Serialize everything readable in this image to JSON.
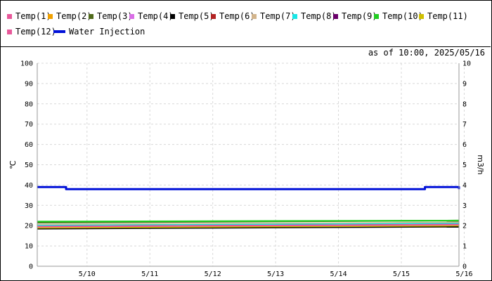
{
  "stamp": "as of 10:00, 2025/05/16",
  "legend": [
    {
      "name": "Temp(1)",
      "color": "#e8589a",
      "kind": "square"
    },
    {
      "name": "Temp(2)",
      "color": "#f0a000",
      "kind": "square"
    },
    {
      "name": "Temp(3)",
      "color": "#4f6a1a",
      "kind": "square"
    },
    {
      "name": "Temp(4)",
      "color": "#d96ee6",
      "kind": "square"
    },
    {
      "name": "Temp(5)",
      "color": "#000000",
      "kind": "square"
    },
    {
      "name": "Temp(6)",
      "color": "#b22222",
      "kind": "square"
    },
    {
      "name": "Temp(7)",
      "color": "#d2b48c",
      "kind": "square"
    },
    {
      "name": "Temp(8)",
      "color": "#19e6e6",
      "kind": "square"
    },
    {
      "name": "Temp(9)",
      "color": "#6a006a",
      "kind": "square"
    },
    {
      "name": "Temp(10)",
      "color": "#22cc22",
      "kind": "square"
    },
    {
      "name": "Temp(11)",
      "color": "#cfc000",
      "kind": "square"
    },
    {
      "name": "Temp(12)",
      "color": "#e8589a",
      "kind": "square"
    },
    {
      "name": "Water Injection",
      "color": "#0010d8",
      "kind": "line"
    }
  ],
  "chart_data": {
    "type": "line",
    "xlabel": "",
    "ylabel": "℃",
    "y2label": "m3/h",
    "x_tick_labels": [
      "5/10",
      "5/11",
      "5/12",
      "5/13",
      "5/14",
      "5/15",
      "5/16"
    ],
    "x_start": "2025/05/09 17:00",
    "x_end": "2025/05/16 10:00",
    "ylim": [
      0,
      100
    ],
    "y2lim": [
      0,
      10
    ],
    "y_ticks": [
      0,
      10,
      20,
      30,
      40,
      50,
      60,
      70,
      80,
      90,
      100
    ],
    "y2_ticks": [
      0,
      1,
      2,
      3,
      4,
      5,
      6,
      7,
      8,
      9,
      10
    ],
    "grid": true,
    "legend_position": "top",
    "series": [
      {
        "name": "Temp(1)",
        "axis": "left",
        "color": "#e8589a",
        "x": [
          "2025/05/09 17:00",
          "2025/05/16 10:00"
        ],
        "values": [
          19.5,
          20.5
        ]
      },
      {
        "name": "Temp(2)",
        "axis": "left",
        "color": "#f0a000",
        "x": [
          "2025/05/09 17:00",
          "2025/05/16 10:00"
        ],
        "values": [
          19.0,
          19.5
        ]
      },
      {
        "name": "Temp(3)",
        "axis": "left",
        "color": "#4f6a1a",
        "x": [
          "2025/05/09 17:00",
          "2025/05/16 10:00"
        ],
        "values": [
          21.5,
          22.5
        ]
      },
      {
        "name": "Temp(4)",
        "axis": "left",
        "color": "#d96ee6",
        "x": [
          "2025/05/09 17:00",
          "2025/05/16 10:00"
        ],
        "values": [
          20.0,
          21.0
        ]
      },
      {
        "name": "Temp(5)",
        "axis": "left",
        "color": "#000000",
        "x": [
          "2025/05/09 17:00",
          "2025/05/16 10:00"
        ],
        "values": [
          18.5,
          19.5
        ]
      },
      {
        "name": "Temp(6)",
        "axis": "left",
        "color": "#b22222",
        "x": [
          "2025/05/09 17:00",
          "2025/05/16 10:00"
        ],
        "values": [
          20.0,
          21.5
        ]
      },
      {
        "name": "Temp(7)",
        "axis": "left",
        "color": "#d2b48c",
        "x": [
          "2025/05/09 17:00",
          "2025/05/16 10:00"
        ],
        "values": [
          20.5,
          21.5
        ]
      },
      {
        "name": "Temp(8)",
        "axis": "left",
        "color": "#19e6e6",
        "x": [
          "2025/05/09 17:00",
          "2025/05/16 10:00"
        ],
        "values": [
          20.0,
          21.0
        ]
      },
      {
        "name": "Temp(9)",
        "axis": "left",
        "color": "#6a006a",
        "x": [
          "2025/05/09 17:00",
          "2025/05/16 10:00"
        ],
        "values": [
          19.5,
          20.5
        ]
      },
      {
        "name": "Temp(10)",
        "axis": "left",
        "color": "#22cc22",
        "x": [
          "2025/05/09 17:00",
          "2025/05/16 10:00"
        ],
        "values": [
          22.0,
          22.5
        ]
      },
      {
        "name": "Temp(11)",
        "axis": "left",
        "color": "#cfc000",
        "x": [
          "2025/05/09 17:00",
          "2025/05/16 10:00"
        ],
        "values": [
          19.0,
          20.0
        ]
      },
      {
        "name": "Temp(12)",
        "axis": "left",
        "color": "#e8589a",
        "x": [
          "2025/05/09 17:00",
          "2025/05/16 10:00"
        ],
        "values": [
          19.5,
          20.5
        ]
      },
      {
        "name": "Water Injection",
        "axis": "right",
        "color": "#0010d8",
        "x": [
          "2025/05/09 17:00",
          "2025/05/10 03:00",
          "2025/05/10 04:00",
          "2025/05/15 20:00",
          "2025/05/15 21:00",
          "2025/05/16 10:00"
        ],
        "values": [
          3.9,
          3.9,
          3.8,
          3.8,
          3.9,
          3.8
        ]
      }
    ]
  }
}
